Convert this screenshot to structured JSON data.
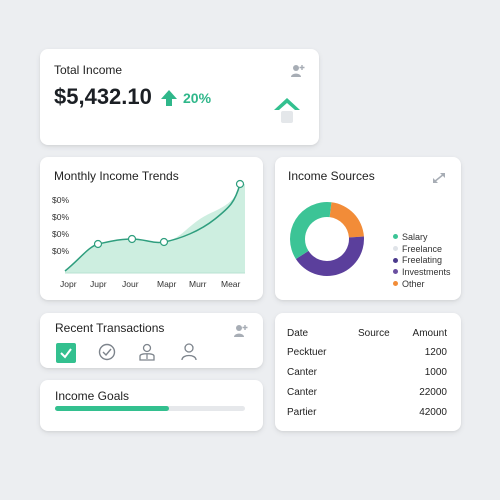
{
  "total_income": {
    "title": "Total Income",
    "amount": "$5,432.10",
    "change": "20%",
    "change_direction": "up",
    "accent": "#2fb78a",
    "icons": [
      "add-user-icon",
      "arrow-up-icon",
      "home-up-icon"
    ]
  },
  "monthly_trends": {
    "title": "Monthly Income Trends",
    "y_labels": [
      "$0%",
      "$0%",
      "$0%",
      "$0%"
    ],
    "x_labels": [
      "Jopr",
      "Jupr",
      "Jour",
      "Mapr",
      "Murr",
      "Mear"
    ],
    "line_color": "#2f9e7e",
    "fill_color": "#cdeee0"
  },
  "income_sources": {
    "title": "Income Sources",
    "icon": "expand-icon",
    "legend": [
      {
        "label": "Salary",
        "color": "#3cc496"
      },
      {
        "label": "Freelance",
        "color": "#dfe3e8"
      },
      {
        "label": "Freelating",
        "color": "#4b3a8c"
      },
      {
        "label": "Investments",
        "color": "#6a4fa0"
      },
      {
        "label": "Other",
        "color": "#f28c38"
      }
    ]
  },
  "chart_data": {
    "type": "pie",
    "title": "Income Sources",
    "categories": [
      "Salary",
      "Investments",
      "Other"
    ],
    "values": [
      36,
      42,
      22
    ],
    "colors": [
      "#3cc496",
      "#5b3f9c",
      "#f28c38"
    ],
    "style": "donut"
  },
  "recent_transactions": {
    "title": "Recent Transactions",
    "icons": [
      "add-user-icon",
      "checkbox-checked-icon",
      "check-circle-icon",
      "user-badge-icon",
      "user-icon"
    ]
  },
  "income_goals": {
    "title": "Income Goals",
    "progress": 0.6,
    "color": "#33c08f"
  },
  "transactions_table": {
    "headers": [
      "Date",
      "Source",
      "Amount"
    ],
    "rows": [
      {
        "date": "Pecktuer",
        "amount": "1200"
      },
      {
        "date": "Canter",
        "amount": "1000"
      },
      {
        "date": "Canter",
        "amount": "22000"
      },
      {
        "date": "Partier",
        "amount": "42000"
      }
    ]
  }
}
